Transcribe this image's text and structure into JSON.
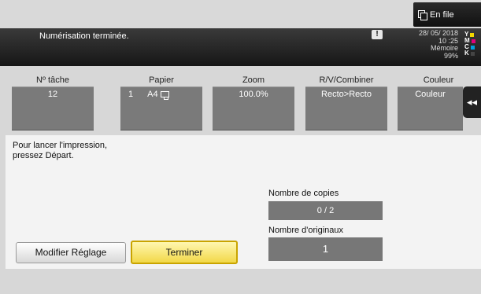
{
  "header": {
    "queue_button_label": "En file",
    "status_message": "Numérisation terminée.",
    "warning_glyph": "!",
    "date": "28/ 05/ 2018",
    "time": "10 :25",
    "memory_label": "Mémoire",
    "memory_value": "99%",
    "toner": [
      {
        "letter": "Y",
        "color": "#f2d600"
      },
      {
        "letter": "M",
        "color": "#e0007a"
      },
      {
        "letter": "C",
        "color": "#00a0e0"
      },
      {
        "letter": "K",
        "color": "#444444"
      }
    ]
  },
  "columns": {
    "job_no": {
      "label": "Nº tâche",
      "value": "12"
    },
    "paper": {
      "label": "Papier",
      "tray": "1",
      "size": "A4"
    },
    "zoom": {
      "label": "Zoom",
      "value": "100.0%"
    },
    "duplex": {
      "label": "R/V/Combiner",
      "value": "Recto>Recto"
    },
    "color": {
      "label": "Couleur",
      "value": "Couleur"
    }
  },
  "side_tab": {
    "glyph": "◂◂"
  },
  "main": {
    "instruction_line1": "Pour lancer l'impression,",
    "instruction_line2": "pressez Départ.",
    "copies_label": "Nombre de copies",
    "copies_value": "0  /  2",
    "originals_label": "Nombre d'originaux",
    "originals_value": "1"
  },
  "buttons": {
    "modify_label": "Modifier Réglage",
    "finish_label": "Terminer"
  }
}
